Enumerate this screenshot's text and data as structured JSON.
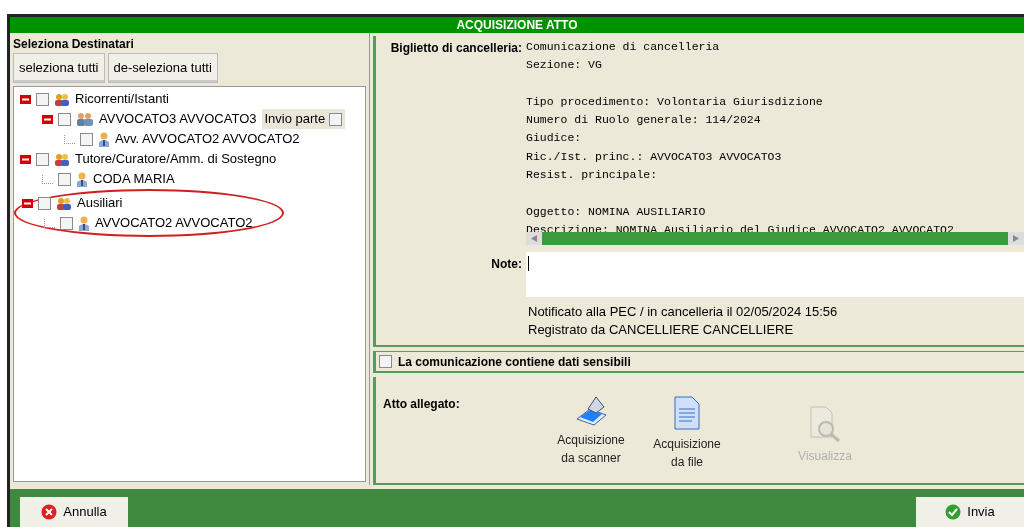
{
  "window": {
    "title": "ACQUISIZIONE ATTO"
  },
  "recipients": {
    "title": "Seleziona Destinatari",
    "buttons": [
      "seleziona tutti",
      "de-seleziona tutti"
    ],
    "tree": [
      {
        "kind": "group",
        "label": "Ricorrenti/Istanti",
        "checked": false,
        "expanded": true,
        "children": [
          {
            "kind": "party",
            "label": "AVVOCATO3 AVVOCATO3",
            "checked": false,
            "expanded": true,
            "send_party": {
              "label": "Invio parte",
              "checked": false
            },
            "children": [
              {
                "kind": "person",
                "label": "Avv. AVVOCATO2 AVVOCATO2",
                "checked": false
              }
            ]
          }
        ]
      },
      {
        "kind": "group",
        "label": "Tutore/Curatore/Amm. di Sostegno",
        "checked": false,
        "expanded": true,
        "children": [
          {
            "kind": "person",
            "label": "CODA MARIA",
            "checked": false
          }
        ]
      },
      {
        "kind": "group",
        "label": "Ausiliari",
        "checked": false,
        "expanded": true,
        "highlighted": true,
        "children": [
          {
            "kind": "person",
            "label": "AVVOCATO2 AVVOCATO2",
            "checked": false
          }
        ]
      }
    ]
  },
  "notice": {
    "label": "Biglietto di cancelleria:",
    "paragraphs": [
      [
        "Comunicazione di cancelleria",
        "Sezione: VG"
      ],
      [
        "Tipo procedimento: Volontaria Giurisdizione",
        "Numero di Ruolo generale: 114/2024",
        "Giudice:",
        "Ric./Ist. princ.: AVVOCATO3 AVVOCATO3",
        "Resist. principale:"
      ],
      [
        "Oggetto: NOMINA AUSILIARIO",
        "Descrizione: NOMINA Ausiliario del Giudice AVVOCATO2 AVVOCATO2"
      ]
    ],
    "note_label": "Note:",
    "status": [
      "Notificato alla PEC / in cancelleria il 02/05/2024 15:56",
      "Registrato da CANCELLIERE CANCELLIERE"
    ]
  },
  "sensitive": {
    "label": "La comunicazione contiene dati sensibili",
    "checked": false
  },
  "attachment": {
    "label": "Atto allegato:",
    "actions": [
      {
        "kind": "scanner",
        "label": "Acquisizione da scanner",
        "disabled": false
      },
      {
        "kind": "file",
        "label": "Acquisizione da file",
        "disabled": false
      },
      {
        "kind": "view",
        "label": "Visualizza",
        "disabled": true
      }
    ]
  },
  "footer": {
    "buttons": [
      {
        "kind": "cancel",
        "label": "Annulla"
      },
      {
        "kind": "send",
        "label": "Invia"
      }
    ]
  }
}
